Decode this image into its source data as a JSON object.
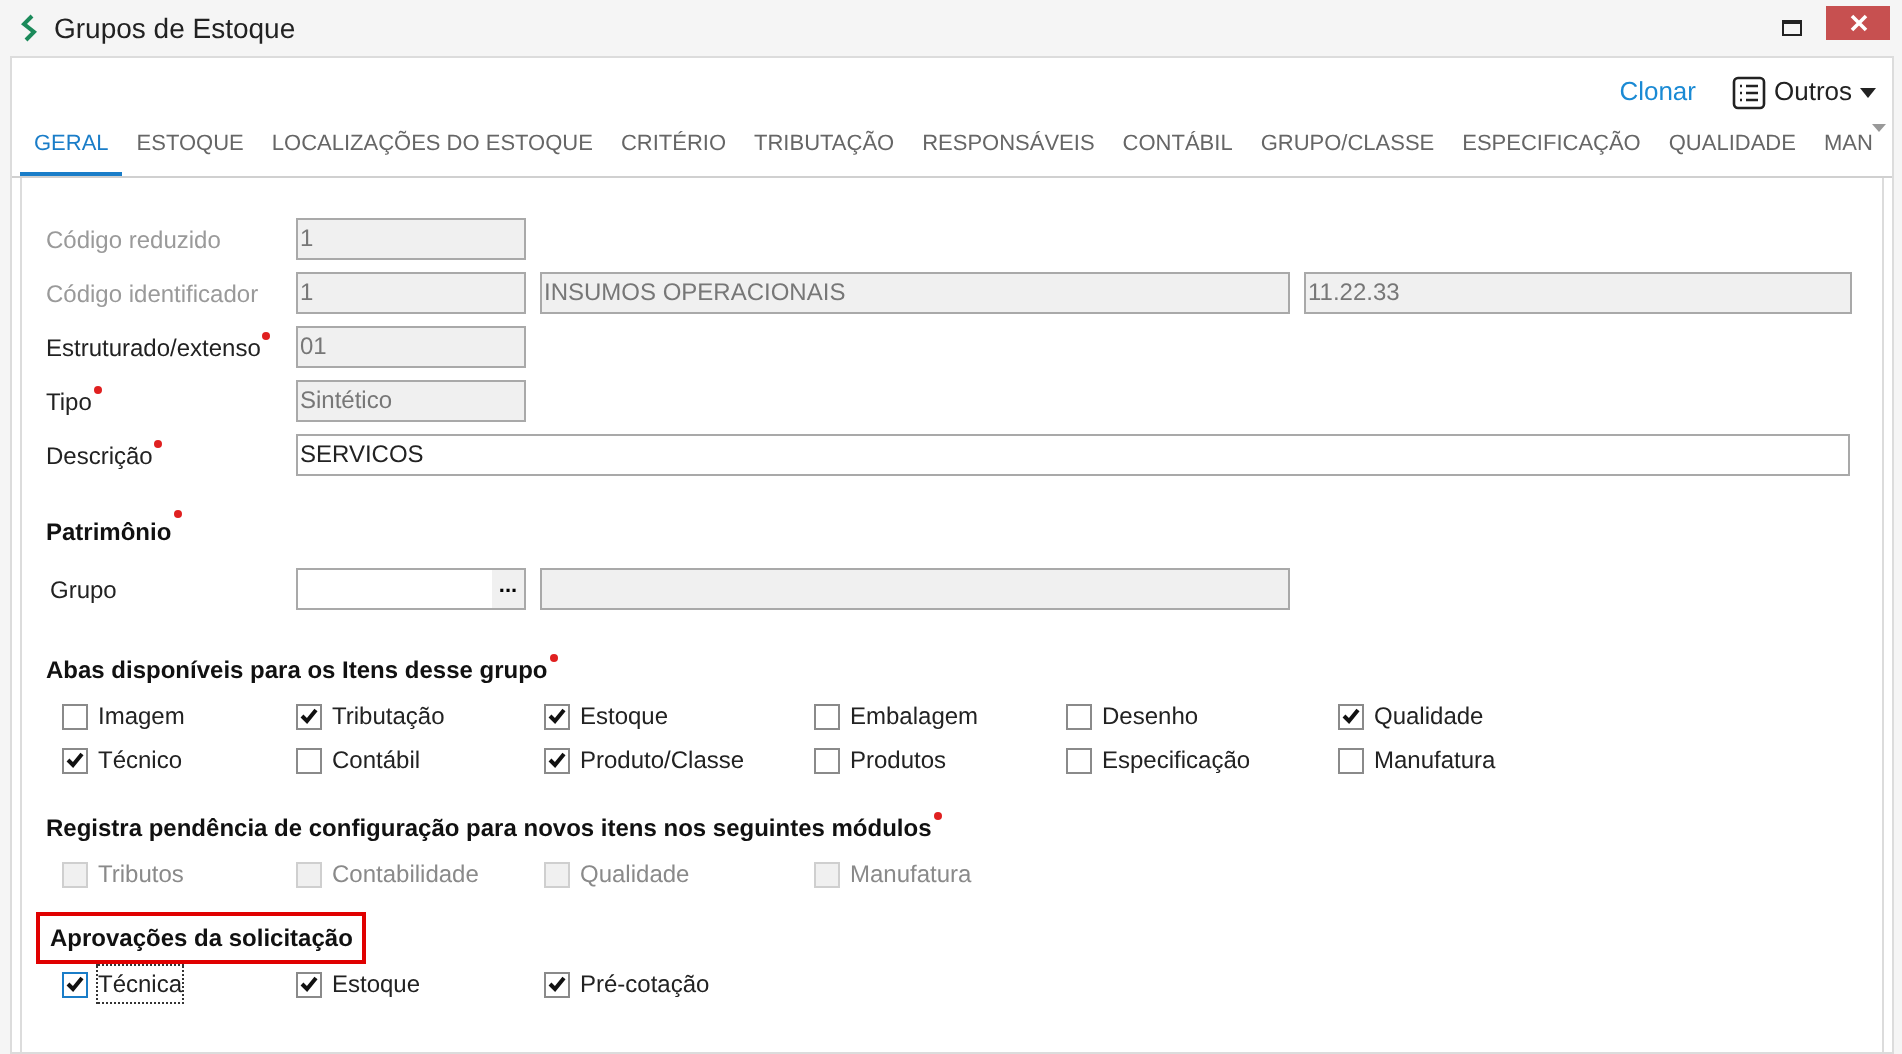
{
  "window": {
    "title": "Grupos de Estoque"
  },
  "toolbar": {
    "clone_link": "Clonar",
    "more_menu": "Outros"
  },
  "tabs": [
    {
      "label": "GERAL",
      "selected": true
    },
    {
      "label": "ESTOQUE",
      "selected": false
    },
    {
      "label": "LOCALIZAÇÕES DO ESTOQUE",
      "selected": false
    },
    {
      "label": "CRITÉRIO",
      "selected": false
    },
    {
      "label": "TRIBUTAÇÃO",
      "selected": false
    },
    {
      "label": "RESPONSÁVEIS",
      "selected": false
    },
    {
      "label": "CONTÁBIL",
      "selected": false
    },
    {
      "label": "GRUPO/CLASSE",
      "selected": false
    },
    {
      "label": "ESPECIFICAÇÃO",
      "selected": false
    },
    {
      "label": "QUALIDADE",
      "selected": false
    },
    {
      "label": "MAN",
      "selected": false
    }
  ],
  "fields": [
    {
      "label": "Código reduzido",
      "disabled": true,
      "required": false,
      "editable": false,
      "values": [
        "1"
      ]
    },
    {
      "label": "Código identificador",
      "disabled": true,
      "required": false,
      "editable": false,
      "values": [
        "1",
        "INSUMOS OPERACIONAIS",
        "11.22.33"
      ]
    },
    {
      "label": "Estruturado/extenso",
      "disabled": false,
      "required": true,
      "editable": false,
      "values": [
        "01"
      ]
    },
    {
      "label": "Tipo",
      "disabled": false,
      "required": true,
      "editable": false,
      "values": [
        "Sintético"
      ]
    },
    {
      "label": "Descrição",
      "disabled": false,
      "required": true,
      "editable": true,
      "values": [
        "SERVICOS"
      ]
    }
  ],
  "patrimonio": {
    "title": "Patrimônio",
    "required": true,
    "group_label": "Grupo",
    "lookup_button": "..."
  },
  "sections": [
    {
      "title": "Abas disponíveis para os Itens desse grupo",
      "required": true,
      "highlighted": false,
      "items": [
        {
          "label": "Imagem",
          "checked": false,
          "disabled": false,
          "focused": false
        },
        {
          "label": "Tributação",
          "checked": true,
          "disabled": false,
          "focused": false
        },
        {
          "label": "Estoque",
          "checked": true,
          "disabled": false,
          "focused": false
        },
        {
          "label": "Embalagem",
          "checked": false,
          "disabled": false,
          "focused": false
        },
        {
          "label": "Desenho",
          "checked": false,
          "disabled": false,
          "focused": false
        },
        {
          "label": "Qualidade",
          "checked": true,
          "disabled": false,
          "focused": false
        },
        {
          "label": "Técnico",
          "checked": true,
          "disabled": false,
          "focused": false
        },
        {
          "label": "Contábil",
          "checked": false,
          "disabled": false,
          "focused": false
        },
        {
          "label": "Produto/Classe",
          "checked": true,
          "disabled": false,
          "focused": false
        },
        {
          "label": "Produtos",
          "checked": false,
          "disabled": false,
          "focused": false
        },
        {
          "label": "Especificação",
          "checked": false,
          "disabled": false,
          "focused": false
        },
        {
          "label": "Manufatura",
          "checked": false,
          "disabled": false,
          "focused": false
        }
      ]
    },
    {
      "title": "Registra pendência de configuração para novos itens nos seguintes módulos",
      "required": true,
      "highlighted": false,
      "items": [
        {
          "label": "Tributos",
          "checked": false,
          "disabled": true,
          "focused": false
        },
        {
          "label": "Contabilidade",
          "checked": false,
          "disabled": true,
          "focused": false
        },
        {
          "label": "Qualidade",
          "checked": false,
          "disabled": true,
          "focused": false
        },
        {
          "label": "Manufatura",
          "checked": false,
          "disabled": true,
          "focused": false
        }
      ]
    },
    {
      "title": "Aprovações da solicitação",
      "required": false,
      "highlighted": true,
      "items": [
        {
          "label": "Técnica",
          "checked": true,
          "disabled": false,
          "focused": true
        },
        {
          "label": "Estoque",
          "checked": true,
          "disabled": false,
          "focused": false
        },
        {
          "label": "Pré-cotação",
          "checked": true,
          "disabled": false,
          "focused": false
        }
      ]
    }
  ]
}
